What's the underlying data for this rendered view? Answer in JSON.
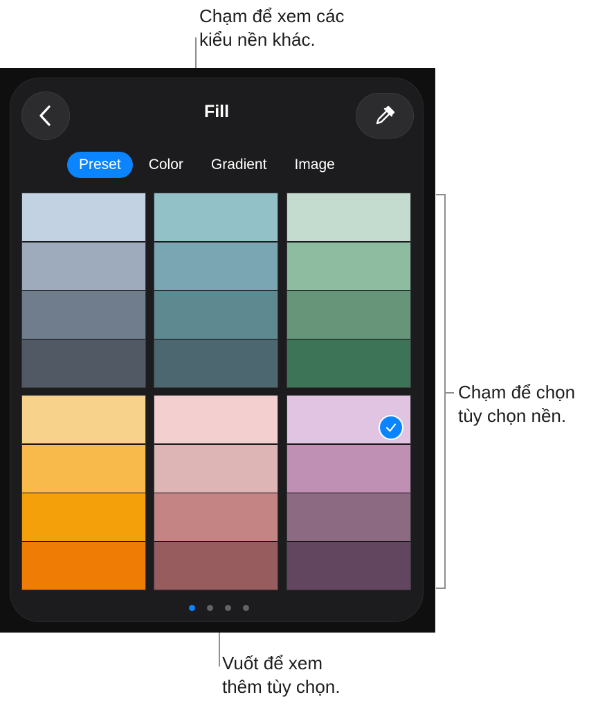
{
  "callouts": {
    "top": "Chạm để xem các\nkiểu nền khác.",
    "right": "Chạm để chọn\ntùy chọn nền.",
    "bottom": "Vuốt để xem\nthêm tùy chọn."
  },
  "header": {
    "title": "Fill",
    "back_icon": "chevron-left-icon",
    "eyedropper_icon": "eyedropper-icon"
  },
  "tabs": [
    {
      "label": "Preset",
      "active": true
    },
    {
      "label": "Color",
      "active": false
    },
    {
      "label": "Gradient",
      "active": false
    },
    {
      "label": "Image",
      "active": false
    }
  ],
  "swatches": [
    {
      "colors": [
        "#c2d2e2",
        "#9eabbc",
        "#6f7d8c",
        "#505964"
      ],
      "selected": false
    },
    {
      "colors": [
        "#92c2c8",
        "#7aa6b3",
        "#5f8990",
        "#4c6770"
      ],
      "selected": false
    },
    {
      "colors": [
        "#c3dccf",
        "#8dbca1",
        "#66957a",
        "#3d7356"
      ],
      "selected": false
    },
    {
      "colors": [
        "#f6d28a",
        "#f8bb4b",
        "#f4a00a",
        "#ef7d05"
      ],
      "selected": false
    },
    {
      "colors": [
        "#f3d0cf",
        "#dcb5b4",
        "#c48484",
        "#965c5e"
      ],
      "selected": false
    },
    {
      "colors": [
        "#e1c4e2",
        "#c090b4",
        "#8c6b82",
        "#62465f"
      ],
      "selected": true
    }
  ],
  "pagination": {
    "total": 4,
    "current": 0
  },
  "colors": {
    "accent": "#0a84ff",
    "panel": "#1c1c1e",
    "screen": "#0f0f0f"
  }
}
